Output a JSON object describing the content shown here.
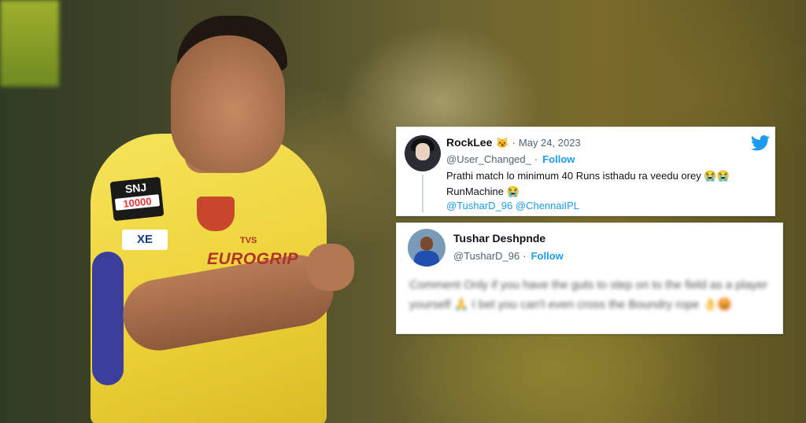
{
  "tweets": [
    {
      "display_name": "RockLee",
      "name_emoji": "😼",
      "date": "May 24, 2023",
      "handle": "@User_Changed_",
      "follow_label": "Follow",
      "text_line1": "Prathi match lo minimum 40 Runs isthadu ra veedu orey 😭😭",
      "text_line2": "RunMachine 😭",
      "mentions": [
        "@TusharD_96",
        "@ChennaiIPL"
      ],
      "icon": "twitter-bird-icon"
    },
    {
      "display_name": "Tushar Deshpnde",
      "handle": "@TusharD_96",
      "follow_label": "Follow",
      "blurred_text": "Comment Only if you have the guts to step on to the field as a player yourself 🙏 I bet you can't even cross the Boundry rope 👌😡"
    }
  ],
  "jersey": {
    "sponsor_badge": "SNJ",
    "sponsor_badge_sub": "10000",
    "chest_text": "EUROGRIP",
    "chest_small": "TVS",
    "sleeve_text": "XE"
  },
  "colors": {
    "jersey_yellow": "#f2dc45",
    "twitter_blue": "#1d9bf0"
  }
}
